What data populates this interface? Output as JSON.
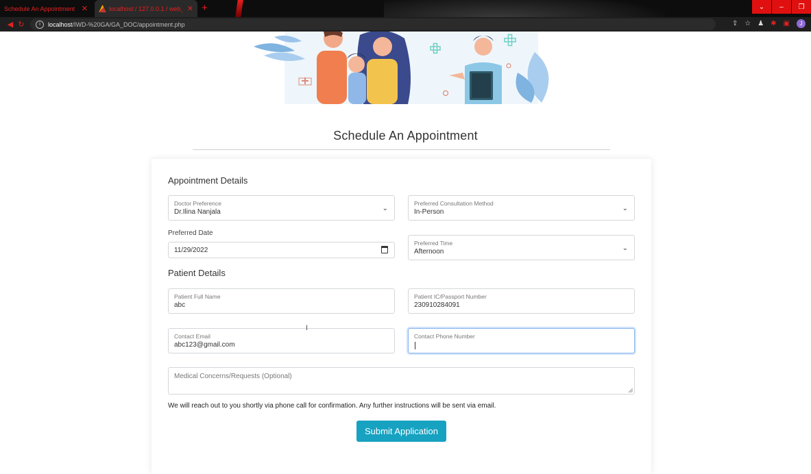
{
  "browser": {
    "tabs": [
      {
        "title": "Schedule An Appointment",
        "close": "✕"
      },
      {
        "title": "localhost / 127.0.0.1 / web_assig",
        "close": "✕"
      }
    ],
    "new_tab": "+",
    "address_host": "localhost",
    "address_path": "/IWD-%20GA/GA_DOC/appointment.php",
    "window_buttons": [
      "⌄",
      "–",
      "❐"
    ],
    "profile_initial": "J"
  },
  "page": {
    "title": "Schedule An Appointment",
    "appointment_section": "Appointment Details",
    "patient_section": "Patient Details",
    "fields": {
      "doctor": {
        "label": "Doctor Preference",
        "value": "Dr.Ilina Nanjala"
      },
      "method": {
        "label": "Preferred Consultation Method",
        "value": "In-Person"
      },
      "date": {
        "label": "Preferred Date",
        "value": "11/29/2022"
      },
      "time": {
        "label": "Preferred Time",
        "value": "Afternoon"
      },
      "name": {
        "label": "Patient Full Name",
        "value": "abc"
      },
      "ic": {
        "label": "Patient IC/Passport Number",
        "value": "230910284091"
      },
      "email": {
        "label": "Contact Email",
        "value": "abc123@gmail.com"
      },
      "phone": {
        "label": "Contact Phone Number",
        "value": ""
      },
      "concerns": {
        "label": "Medical Concerns/Requests (Optional)",
        "value": ""
      }
    },
    "notice": "We will reach out to you shortly via phone call for confirmation. Any further instructions will be sent via email.",
    "submit_label": "Submit Application"
  },
  "colors": {
    "accent": "#17a2c1",
    "focus_border": "#87b3ea",
    "browser_accent": "#e52020"
  }
}
